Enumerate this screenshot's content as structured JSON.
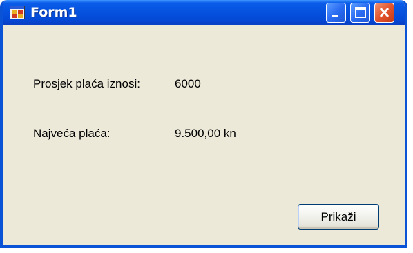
{
  "window": {
    "title": "Form1"
  },
  "labels": {
    "average_caption": "Prosjek plaća iznosi:",
    "average_value": "6000",
    "max_caption": "Najveća plaća:",
    "max_value": "9.500,00 kn"
  },
  "buttons": {
    "show_label": "Prikaži"
  },
  "icons": {
    "app": "form-app-icon",
    "minimize": "minimize-icon",
    "maximize": "maximize-icon",
    "close": "close-icon"
  },
  "colors": {
    "titlebar": "#0653e0",
    "window_border": "#0a52d6",
    "client_background": "#ece9d8",
    "close_button": "#e2552d"
  }
}
